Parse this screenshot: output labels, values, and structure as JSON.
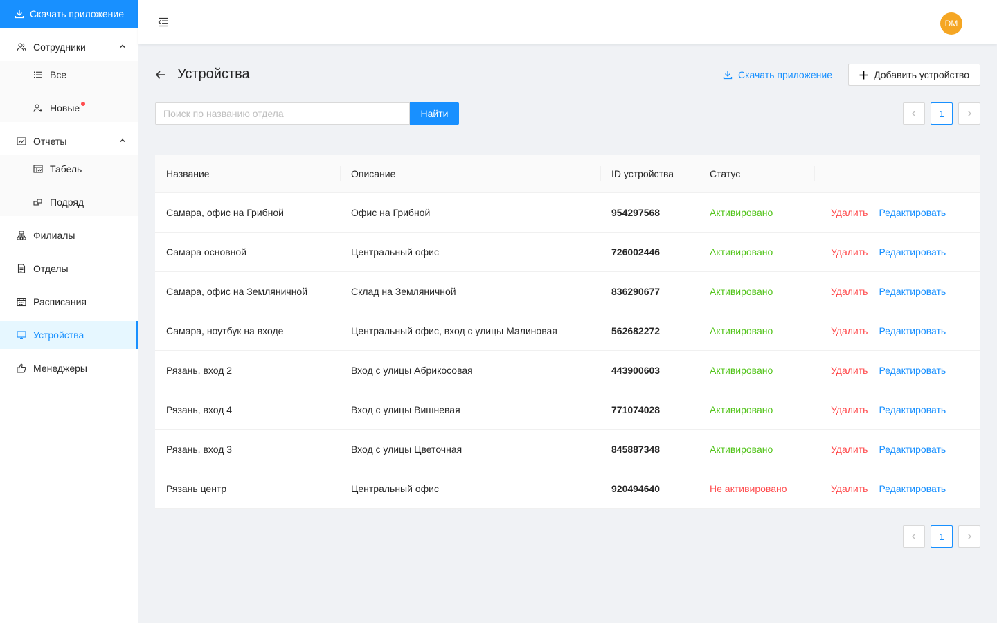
{
  "sidebar": {
    "download_label": "Скачать приложение",
    "items": [
      {
        "label": "Сотрудники"
      },
      {
        "label": "Все"
      },
      {
        "label": "Новые"
      },
      {
        "label": "Отчеты"
      },
      {
        "label": "Табель"
      },
      {
        "label": "Подряд"
      },
      {
        "label": "Филиалы"
      },
      {
        "label": "Отделы"
      },
      {
        "label": "Расписания"
      },
      {
        "label": "Устройства"
      },
      {
        "label": "Менеджеры"
      }
    ]
  },
  "header": {
    "avatar_initials": "DM"
  },
  "page": {
    "title": "Устройства",
    "download_link": "Скачать приложение",
    "add_button": "Добавить устройство"
  },
  "search": {
    "placeholder": "Поиск по названию отдела",
    "value": "",
    "button": "Найти"
  },
  "pagination": {
    "current_page": "1"
  },
  "table": {
    "columns": [
      "Название",
      "Описание",
      "ID устройства",
      "Статус",
      ""
    ],
    "delete_label": "Удалить",
    "edit_label": "Редактировать",
    "rows": [
      {
        "name": "Самара, офис на Грибной",
        "description": "Офис на Грибной",
        "id": "954297568",
        "status": "Активировано",
        "active": true
      },
      {
        "name": "Самара основной",
        "description": "Центральный офис",
        "id": "726002446",
        "status": "Активировано",
        "active": true
      },
      {
        "name": "Самара, офис на Земляничной",
        "description": "Склад на Земляничной",
        "id": "836290677",
        "status": "Активировано",
        "active": true
      },
      {
        "name": "Самара, ноутбук на входе",
        "description": "Центральный офис, вход с улицы Малиновая",
        "id": "562682272",
        "status": "Активировано",
        "active": true
      },
      {
        "name": "Рязань, вход 2",
        "description": "Вход с улицы Абрикосовая",
        "id": "443900603",
        "status": "Активировано",
        "active": true
      },
      {
        "name": "Рязань, вход 4",
        "description": "Вход с улицы Вишневая",
        "id": "771074028",
        "status": "Активировано",
        "active": true
      },
      {
        "name": "Рязань, вход 3",
        "description": "Вход с улицы Цветочная",
        "id": "845887348",
        "status": "Активировано",
        "active": true
      },
      {
        "name": "Рязань центр",
        "description": "Центральный офис",
        "id": "920494640",
        "status": "Не активировано",
        "active": false
      }
    ]
  },
  "colors": {
    "primary": "#1890ff",
    "success": "#52c41a",
    "danger": "#ff4d4f",
    "avatar": "#f5a623"
  }
}
